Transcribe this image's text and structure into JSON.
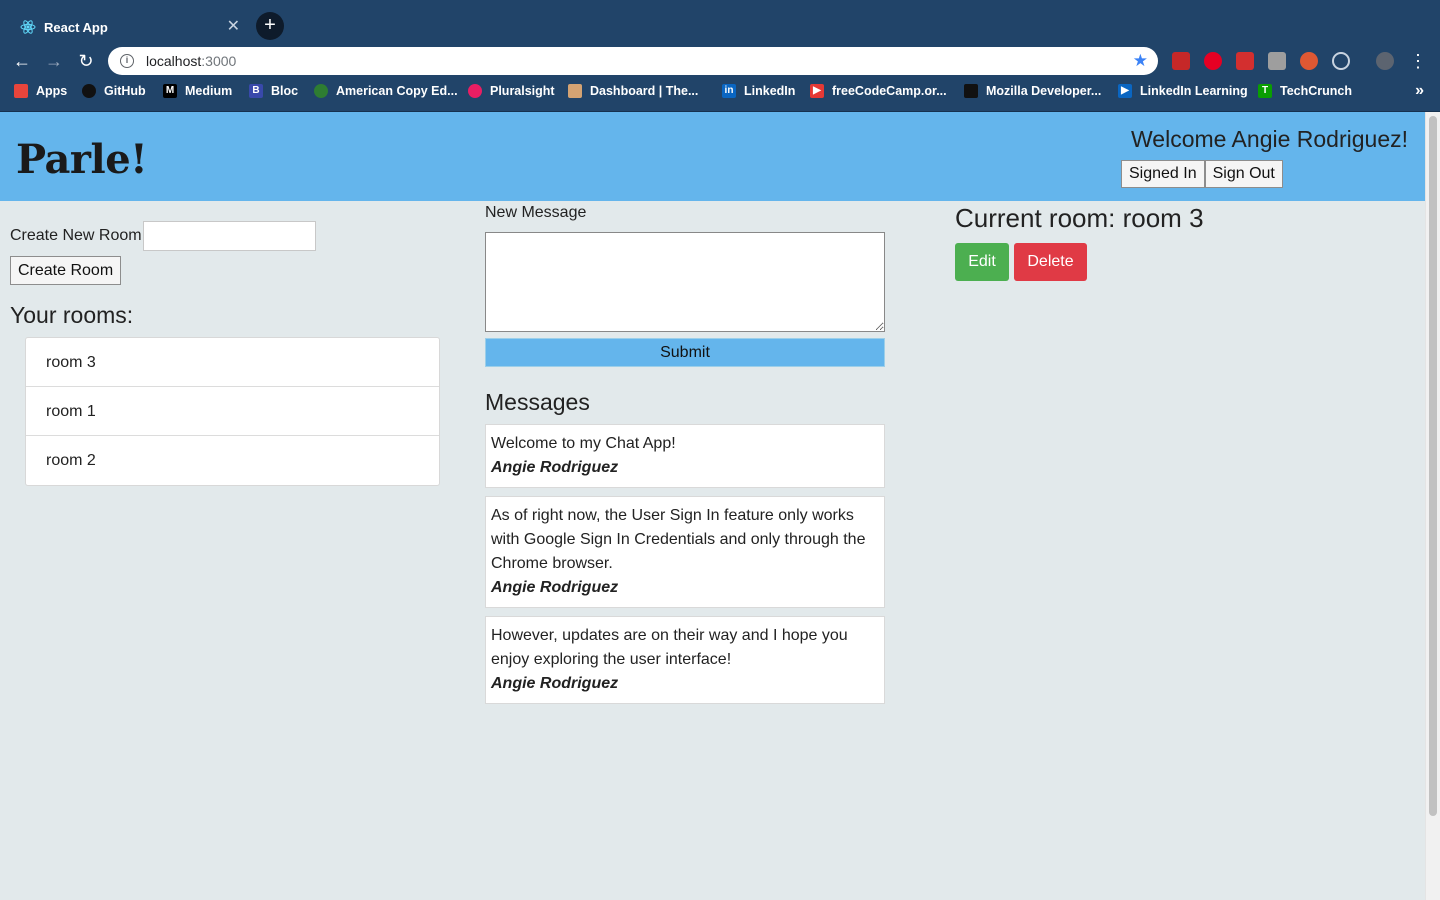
{
  "browser": {
    "tab_title": "React App",
    "url_host": "localhost",
    "url_port": ":3000",
    "bookmarks": [
      {
        "label": "Apps",
        "icon": "apps-grid-icon",
        "color": "#e8453c"
      },
      {
        "label": "GitHub",
        "icon": "github-icon",
        "color": "#111111"
      },
      {
        "label": "Medium",
        "icon": "medium-icon",
        "color": "#000000"
      },
      {
        "label": "Bloc",
        "icon": "bloc-icon",
        "color": "#3949ab"
      },
      {
        "label": "American Copy Ed...",
        "icon": "american-copy-icon",
        "color": "#2e7d32"
      },
      {
        "label": "Pluralsight",
        "icon": "pluralsight-icon",
        "color": "#e91e63"
      },
      {
        "label": "Dashboard | The...",
        "icon": "dashboard-icon",
        "color": "#d4a373"
      },
      {
        "label": "LinkedIn",
        "icon": "linkedin-icon",
        "color": "#0a66c2"
      },
      {
        "label": "freeCodeCamp.or...",
        "icon": "freecodecamp-icon",
        "color": "#e53935"
      },
      {
        "label": "Mozilla Developer...",
        "icon": "mozilla-icon",
        "color": "#111111"
      },
      {
        "label": "LinkedIn Learning",
        "icon": "linkedin-learning-icon",
        "color": "#0a66c2"
      },
      {
        "label": "TechCrunch",
        "icon": "techcrunch-icon",
        "color": "#0a9e01"
      }
    ]
  },
  "header": {
    "brand": "Parle!",
    "welcome": "Welcome Angie Rodriguez!",
    "signed_in_label": "Signed In",
    "sign_out_label": "Sign Out",
    "color": "#64b5ec"
  },
  "sidebar": {
    "create_label": "Create New Room",
    "create_button": "Create Room",
    "rooms_title": "Your rooms:",
    "rooms": [
      "room 3",
      "room 1",
      "room 2"
    ]
  },
  "composer": {
    "label": "New Message",
    "submit_label": "Submit"
  },
  "messages": {
    "title": "Messages",
    "items": [
      {
        "text": "Welcome to my Chat App!",
        "author": "Angie Rodriguez"
      },
      {
        "text": "As of right now, the User Sign In feature only works with Google Sign In Credentials and only through the Chrome browser.",
        "author": "Angie Rodriguez"
      },
      {
        "text": "However, updates are on their way and I hope you enjoy exploring the user interface!",
        "author": "Angie Rodriguez"
      }
    ]
  },
  "room_panel": {
    "current_room": "Current room: room 3",
    "edit_label": "Edit",
    "delete_label": "Delete",
    "edit_color": "#4caf50",
    "delete_color": "#e03a45"
  }
}
